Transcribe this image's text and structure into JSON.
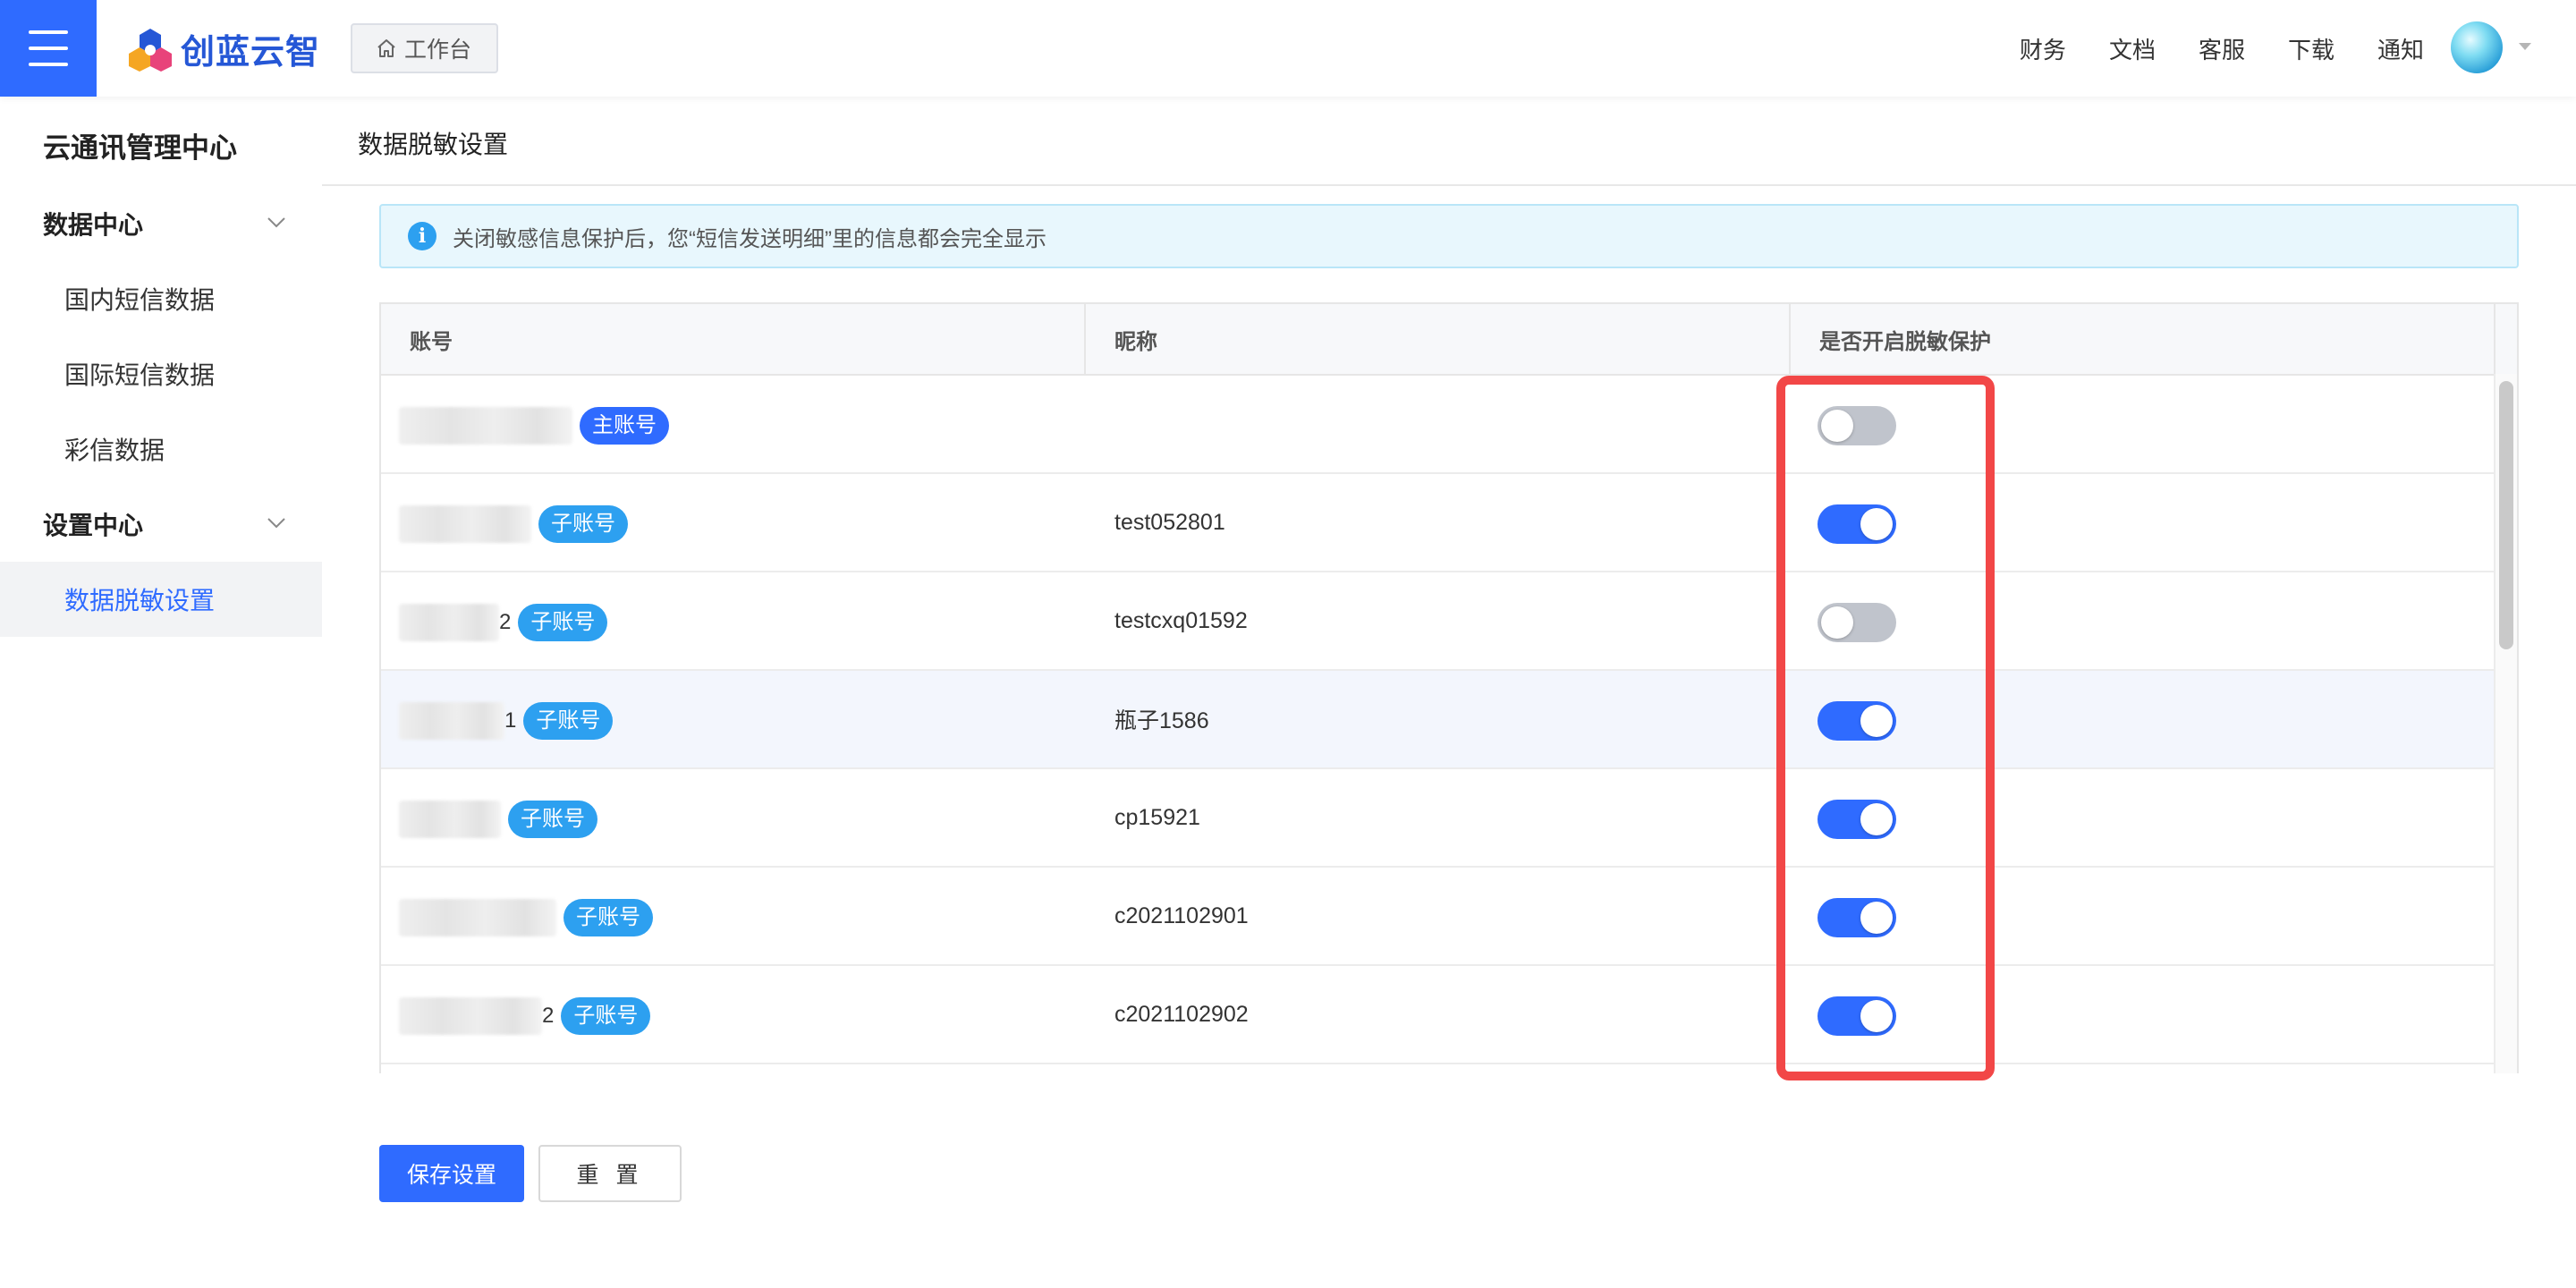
{
  "header": {
    "logo_text": "创蓝云智",
    "workbench_label": "工作台",
    "nav": [
      "财务",
      "文档",
      "客服",
      "下载",
      "通知"
    ]
  },
  "sidebar": {
    "title": "云通讯管理中心",
    "groups": [
      {
        "label": "数据中心",
        "items": [
          "国内短信数据",
          "国际短信数据",
          "彩信数据"
        ]
      },
      {
        "label": "设置中心",
        "items": [
          "数据脱敏设置"
        ]
      }
    ],
    "active_item": "数据脱敏设置"
  },
  "page": {
    "title": "数据脱敏设置",
    "alert": "关闭敏感信息保护后，您“短信发送明细”里的信息都会完全显示"
  },
  "table": {
    "columns": [
      "账号",
      "昵称",
      "是否开启脱敏保护"
    ],
    "rows": [
      {
        "account_suffix": "",
        "badge": "主账号",
        "nickname": "",
        "protected": false
      },
      {
        "account_suffix": "",
        "badge": "子账号",
        "nickname": "test052801",
        "protected": true
      },
      {
        "account_suffix": "2",
        "badge": "子账号",
        "nickname": "testcxq01592",
        "protected": false
      },
      {
        "account_suffix": "1",
        "badge": "子账号",
        "nickname": "瓶子1586",
        "protected": true
      },
      {
        "account_suffix": "",
        "badge": "子账号",
        "nickname": "cp15921",
        "protected": true
      },
      {
        "account_suffix": "",
        "badge": "子账号",
        "nickname": "c2021102901",
        "protected": true
      },
      {
        "account_suffix": "2",
        "badge": "子账号",
        "nickname": "c2021102902",
        "protected": true
      }
    ]
  },
  "actions": {
    "save_label": "保存设置",
    "reset_label": "重 置"
  },
  "colors": {
    "primary": "#2f6bff",
    "badge": "#2da0f0",
    "highlight": "#f24747",
    "switch_off": "#c0c4cc"
  }
}
